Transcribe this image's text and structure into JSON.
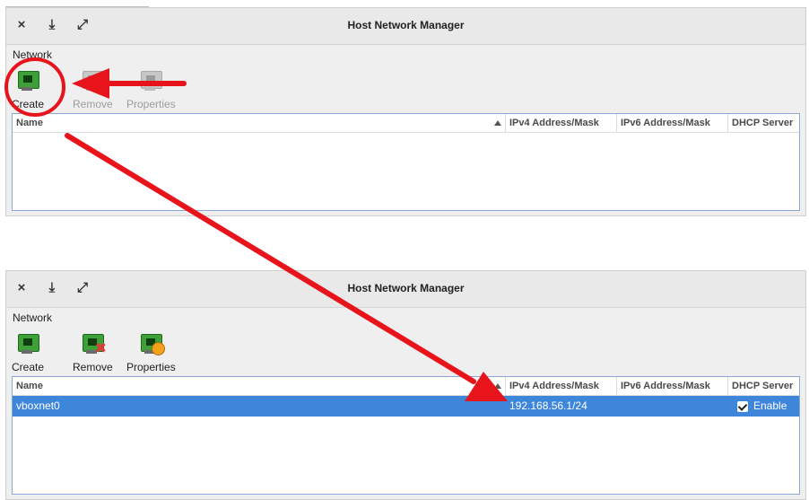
{
  "windows": [
    {
      "title": "Host Network Manager",
      "menu": "Network",
      "toolbar": {
        "create": "Create",
        "remove": "Remove",
        "properties": "Properties",
        "remove_enabled": false,
        "properties_enabled": false
      },
      "columns": [
        "Name",
        "IPv4 Address/Mask",
        "IPv6 Address/Mask",
        "DHCP Server"
      ],
      "rows": []
    },
    {
      "title": "Host Network Manager",
      "menu": "Network",
      "toolbar": {
        "create": "Create",
        "remove": "Remove",
        "properties": "Properties",
        "remove_enabled": true,
        "properties_enabled": true
      },
      "columns": [
        "Name",
        "IPv4 Address/Mask",
        "IPv6 Address/Mask",
        "DHCP Server"
      ],
      "rows": [
        {
          "name": "vboxnet0",
          "ipv4": "192.168.56.1/24",
          "ipv6": "",
          "dhcp": "Enable",
          "dhcp_enabled": true
        }
      ]
    }
  ],
  "titlebar_icons": [
    "close-icon",
    "download-icon",
    "maximize-icon"
  ],
  "annotation_color": "#e8141b"
}
